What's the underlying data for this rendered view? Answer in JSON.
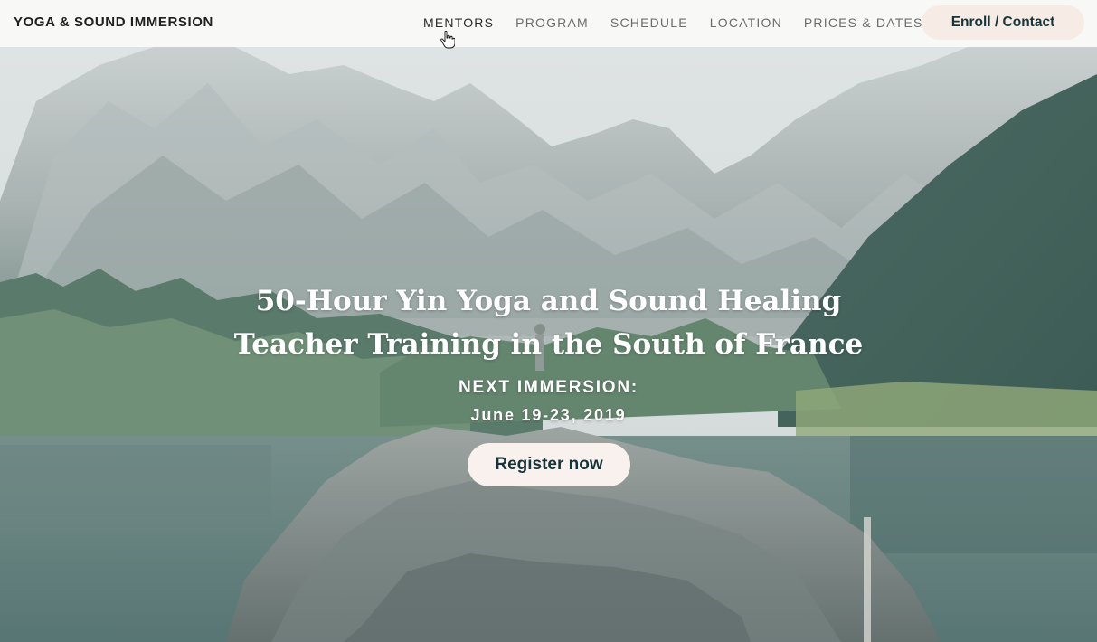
{
  "header": {
    "brand": "YOGA & SOUND IMMERSION",
    "nav": [
      {
        "label": "MENTORS"
      },
      {
        "label": "PROGRAM"
      },
      {
        "label": "SCHEDULE"
      },
      {
        "label": "LOCATION"
      },
      {
        "label": "PRICES & DATES"
      }
    ],
    "cta": "Enroll / Contact"
  },
  "hero": {
    "title_line1": "50-Hour Yin Yoga and Sound Healing",
    "title_line2": "Teacher Training in the South of France",
    "next_label": "NEXT IMMERSION:",
    "next_date": "June 19-23, 2019",
    "register": "Register now",
    "background": "mountain-lake-image"
  },
  "colors": {
    "header_bg": "#f8f8f7",
    "button_bg": "#f6ebe5",
    "button_text": "#17343a",
    "hero_text": "#ffffff"
  },
  "cursor": "hand-pointer-icon"
}
